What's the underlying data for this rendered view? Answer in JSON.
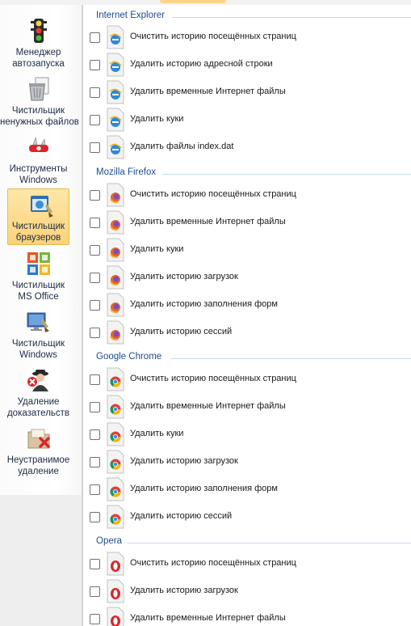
{
  "sidebar": {
    "items": [
      {
        "label_1": "Менеджер",
        "label_2": "автозапуска",
        "icon": "traffic-light-icon",
        "active": false
      },
      {
        "label_1": "Чистильщик",
        "label_2": "ненужных файлов",
        "icon": "trash-files-icon",
        "active": false
      },
      {
        "label_1": "Инструменты",
        "label_2": "Windows",
        "icon": "swiss-knife-icon",
        "active": false
      },
      {
        "label_1": "Чистильщик",
        "label_2": "браузеров",
        "icon": "browser-cleaner-icon",
        "active": true
      },
      {
        "label_1": "Чистильщик",
        "label_2": "MS Office",
        "icon": "ms-office-icon",
        "active": false
      },
      {
        "label_1": "Чистильщик",
        "label_2": "Windows",
        "icon": "windows-cleaner-icon",
        "active": false
      },
      {
        "label_1": "Удаление",
        "label_2": "доказательств",
        "icon": "spy-icon",
        "active": false
      },
      {
        "label_1": "Неустранимое",
        "label_2": "удаление",
        "icon": "shred-folder-icon",
        "active": false
      }
    ]
  },
  "groups": [
    {
      "title": "Internet Explorer",
      "browser": "ie",
      "items": [
        "Очистить историю посещённых страниц",
        "Удалить историю адресной строки",
        "Удалить временные Интернет файлы",
        "Удалить куки",
        "Удалить файлы index.dat"
      ]
    },
    {
      "title": "Mozilla Firefox",
      "browser": "firefox",
      "items": [
        "Очистить историю посещённых страниц",
        "Удалить временные Интернет файлы",
        "Удалить куки",
        "Удалить историю загрузок",
        "Удалить историю заполнения форм",
        "Удалить историю сессий"
      ]
    },
    {
      "title": "Google Chrome",
      "browser": "chrome",
      "items": [
        "Очистить историю посещённых страниц",
        "Удалить временные Интернет файлы",
        "Удалить куки",
        "Удалить историю загрузок",
        "Удалить историю заполнения форм",
        "Удалить историю сессий"
      ]
    },
    {
      "title": "Opera",
      "browser": "opera",
      "items": [
        "Очистить историю посещённых страниц",
        "Удалить историю загрузок",
        "Удалить временные Интернет файлы"
      ]
    }
  ],
  "colors": {
    "accent": "#fbd27b",
    "group_title": "#1d4b8f"
  }
}
